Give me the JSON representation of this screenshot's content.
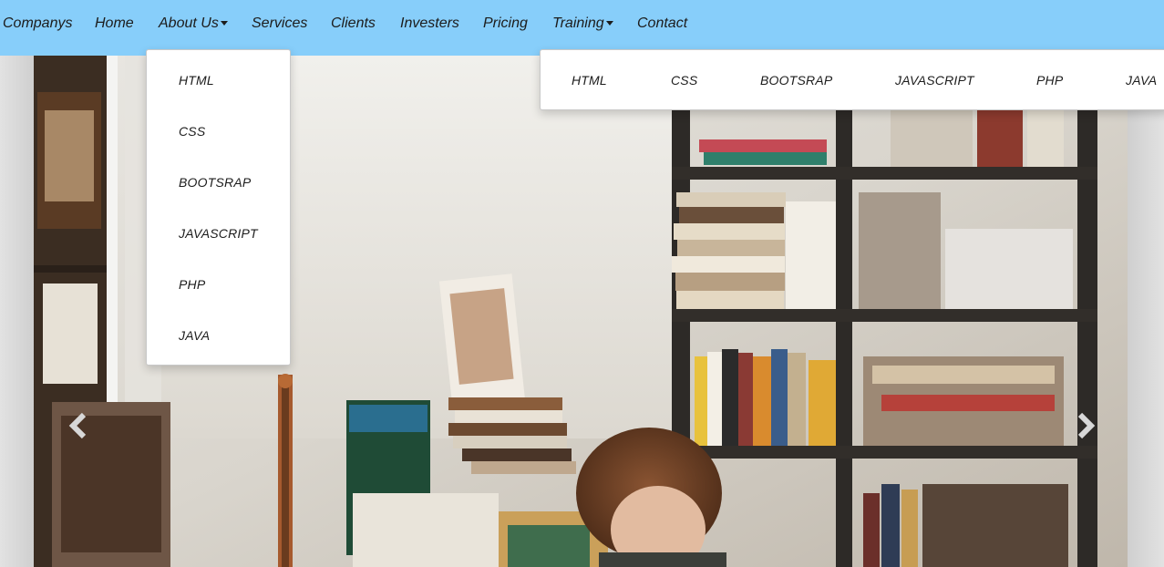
{
  "navbar": {
    "brand": "Companys",
    "items": [
      {
        "label": "Home"
      },
      {
        "label": "About Us"
      },
      {
        "label": "Services"
      },
      {
        "label": "Clients"
      },
      {
        "label": "Investers"
      },
      {
        "label": "Pricing"
      },
      {
        "label": "Training"
      },
      {
        "label": "Contact"
      }
    ],
    "background_color": "#87cefa"
  },
  "about_dropdown": {
    "items": [
      "HTML",
      "CSS",
      "BOOTSRAP",
      "JAVASCRIPT",
      "PHP",
      "JAVA"
    ]
  },
  "training_dropdown": {
    "items": [
      "HTML",
      "CSS",
      "BOOTSRAP",
      "JAVASCRIPT",
      "PHP",
      "JAVA"
    ]
  },
  "carousel": {
    "prev_icon": "chevron-left-icon",
    "next_icon": "chevron-right-icon"
  }
}
